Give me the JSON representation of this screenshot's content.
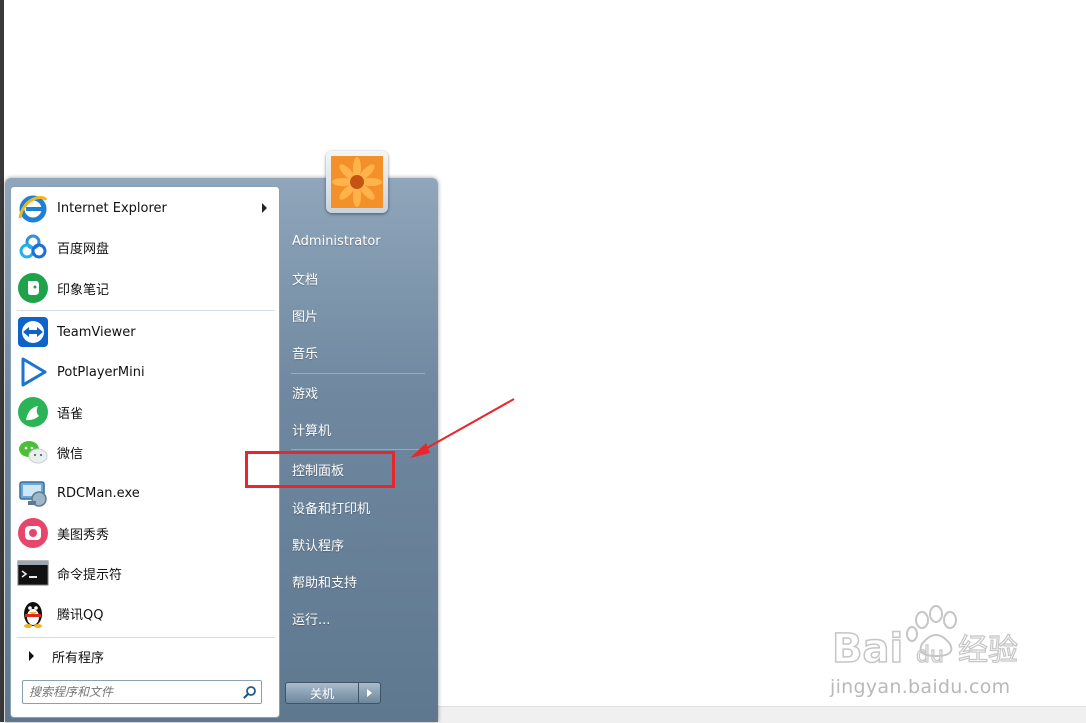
{
  "start_menu": {
    "programs": [
      {
        "label": "Internet Explorer",
        "icon": "internet-explorer-icon",
        "has_submenu": true
      },
      {
        "label": "百度网盘",
        "icon": "baidu-netdisk-icon"
      },
      {
        "label": "印象笔记",
        "icon": "evernote-icon"
      },
      {
        "label": "TeamViewer",
        "icon": "teamviewer-icon"
      },
      {
        "label": "PotPlayerMini",
        "icon": "potplayer-icon"
      },
      {
        "label": "语雀",
        "icon": "yuque-icon"
      },
      {
        "label": "微信",
        "icon": "wechat-icon"
      },
      {
        "label": "RDCMan.exe",
        "icon": "rdcman-icon"
      },
      {
        "label": "美图秀秀",
        "icon": "meitu-icon"
      },
      {
        "label": "命令提示符",
        "icon": "command-prompt-icon"
      },
      {
        "label": "腾讯QQ",
        "icon": "qq-penguin-icon"
      }
    ],
    "all_programs_label": "所有程序",
    "search_placeholder": "搜索程序和文件",
    "right_items": [
      {
        "label": "Administrator"
      },
      {
        "label": "文档"
      },
      {
        "label": "图片"
      },
      {
        "label": "音乐"
      },
      {
        "label": "游戏"
      },
      {
        "label": "计算机"
      },
      {
        "label": "控制面板",
        "highlighted": true
      },
      {
        "label": "设备和打印机"
      },
      {
        "label": "默认程序"
      },
      {
        "label": "帮助和支持"
      },
      {
        "label": "运行..."
      }
    ],
    "shutdown_label": "关机"
  },
  "watermark": {
    "brand": "Baidu",
    "chinese": "经验",
    "url": "jingyan.baidu.com"
  },
  "colors": {
    "highlight": "#e8262b",
    "menu_right_pane": "#6f889f"
  }
}
